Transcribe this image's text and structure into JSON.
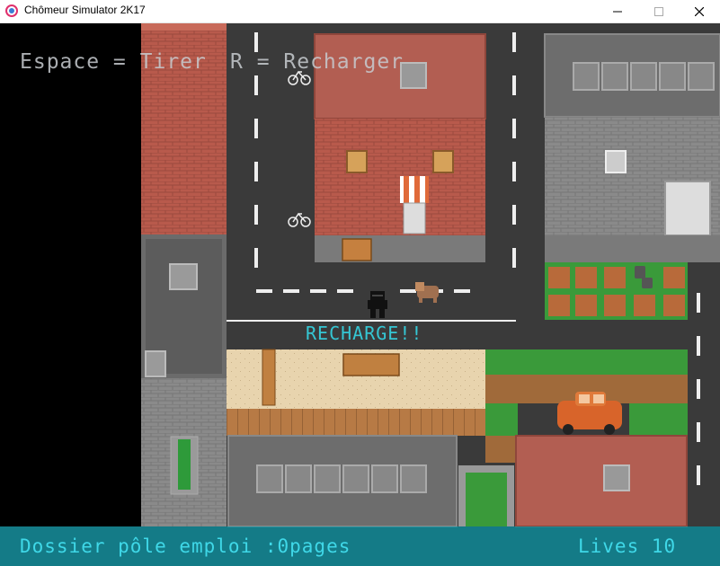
{
  "window": {
    "title": "Chômeur Simulator 2K17",
    "minimize_icon": "minimize-icon",
    "maximize_icon": "maximize-icon",
    "close_icon": "close-icon"
  },
  "hud": {
    "shoot_hint": "Espace = Tirer",
    "reload_hint": "R = Recharger",
    "status_message": "RECHARGE!!",
    "dossier_text": "Dossier pôle emploi :0pages",
    "lives_text": "Lives 10"
  },
  "colors": {
    "hud_text": "#3fd8e8",
    "status_text": "#35c7d4",
    "hud_bar": "#1896a5",
    "road": "#3a3a3a",
    "brick": "#b55a4c",
    "car": "#d8642a"
  }
}
